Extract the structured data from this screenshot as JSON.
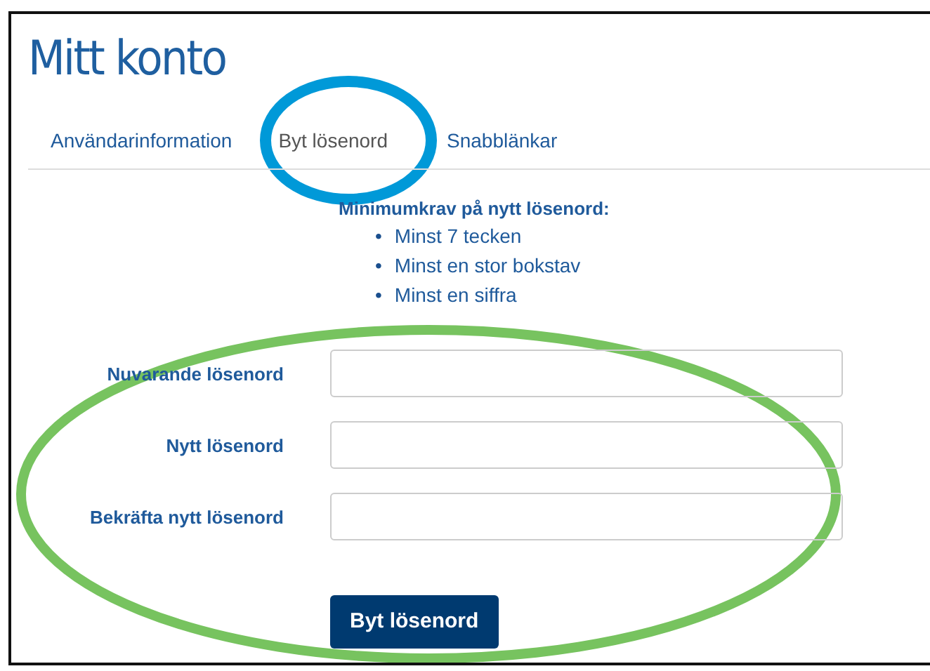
{
  "title": "Mitt konto",
  "tabs": [
    {
      "label": "Användarinformation",
      "selected": false
    },
    {
      "label": "Byt lösenord",
      "selected": true
    },
    {
      "label": "Snabblänkar",
      "selected": false
    }
  ],
  "requirements": {
    "heading": "Minimumkrav på nytt lösenord:",
    "items": [
      {
        "marker": "•",
        "text": "Minst 7 tecken"
      },
      {
        "marker": "•",
        "text": "Minst en stor bokstav"
      },
      {
        "marker": "•",
        "text": "Minst en siffra"
      }
    ]
  },
  "fields": [
    {
      "label": "Nuvarande lösenord"
    },
    {
      "label": "Nytt lösenord"
    },
    {
      "label": "Bekräfta nytt lösenord"
    }
  ],
  "submit_button": "Byt lösenord",
  "annotations": [
    {
      "kind": "ellipse",
      "color": "#0099d8"
    },
    {
      "kind": "ellipse",
      "color": "#77c35f"
    }
  ]
}
